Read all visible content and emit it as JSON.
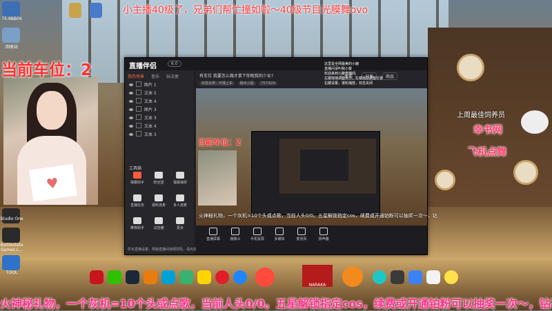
{
  "desktop": {
    "icons": [
      {
        "label": "75.9BB04",
        "color": "#3d6fb5"
      },
      {
        "label": "回收站",
        "color": "#7aa0c8"
      },
      {
        "label": "",
        "color": "#c9a34a"
      },
      {
        "label": "",
        "color": "#4a7bc9"
      },
      {
        "label": "Studio One",
        "color": "#2a2a2a"
      },
      {
        "label": "Battlestate Games L...",
        "color": "#2a2a2a"
      },
      {
        "label": "TOOL",
        "color": "#2f73c8"
      }
    ]
  },
  "overlays": {
    "top_banner": "小主播40级了，兄弟们帮忙撞如啦～40级节目光膜舞ovo",
    "car_position": "当前车位：2",
    "week_label": "上周最佳饲养员",
    "right_line1": "幸书网",
    "right_line2": "飞机点舞",
    "bottom_scroll": "火神秘礼物，一个灰机=10个头或点歌，当前人头0/0。五星解锁指定cos，续费或开通铂粉可以抽奖一次～，钻石"
  },
  "app": {
    "title": "直播伴侣",
    "version": "6.0",
    "sidebar_tabs": [
      "我的场景",
      "音乐",
      "玩法类"
    ],
    "scenes": [
      {
        "label": "图片 1"
      },
      {
        "label": "文本 5"
      },
      {
        "label": "文本 4"
      },
      {
        "label": "图片 3"
      },
      {
        "label": "文本 3"
      },
      {
        "label": "文本 4"
      },
      {
        "label": "文本 3"
      }
    ],
    "tools_header": "工具箱",
    "tools": [
      {
        "label": "弹幕助手",
        "color": "#ff5b3a"
      },
      {
        "label": "粉丝团",
        "color": "#e6e6e6"
      },
      {
        "label": "福袋抽奖",
        "color": "#e6e6e6"
      },
      {
        "label": "直播任务",
        "color": "#e6e6e6"
      },
      {
        "label": "视听连麦",
        "color": "#e6e6e6"
      },
      {
        "label": "多人连麦",
        "color": "#e6e6e6"
      },
      {
        "label": "推荐助手",
        "color": "#e6e6e6"
      },
      {
        "label": "试音棚",
        "color": "#e6e6e6"
      },
      {
        "label": "更多",
        "color": "#e6e6e6"
      }
    ],
    "footer_note": "优化直播设置，规避直播间违规风险，请点击查看并同意",
    "preview": {
      "title": "有车位 我要怎么做才拿下你呢我的少女?",
      "tags": [
        "标签名称：开播上车",
        "播出小屋",
        "757/924"
      ],
      "buttons": [
        "发布",
        "分享",
        "商品"
      ],
      "sub_line": "火神秘礼物，一个灰机=10个头或点歌，当前人头0/0。五星解锁指定cos，续费或开通铂粉可以抽奖一次～，钻"
    },
    "chat": [
      "这里是全网最美的小鹿",
      "直播间请叫我小葵",
      "欢迎来到小葵直播间",
      "左键拖拽调整大小，左键拖动调整位置",
      "右键设置，滚轮缩放，双击关闭"
    ],
    "controls": [
      {
        "label": "直播屏幕"
      },
      {
        "label": "摄像头"
      },
      {
        "label": "手机投屏"
      },
      {
        "label": "多媒体"
      },
      {
        "label": "麦克风"
      },
      {
        "label": "扬声器"
      }
    ]
  },
  "taskbar": {
    "apps": [
      {
        "name": "NetEase",
        "color": "#c8141c"
      },
      {
        "name": "WeChat",
        "color": "#2dc100"
      },
      {
        "name": "Steam",
        "color": "#1b2838"
      },
      {
        "name": "Blender",
        "color": "#e87d0d"
      },
      {
        "name": "Bilibili",
        "color": "#00a1d6"
      },
      {
        "name": "Nut",
        "color": "#37b26f"
      },
      {
        "name": "Cartoon",
        "color": "#ffd400"
      },
      {
        "name": "NetEase Music",
        "color": "#e11d2a"
      },
      {
        "name": "Kugou",
        "color": "#1e86ff"
      },
      {
        "name": "Bird",
        "color": "#ff4b3e"
      },
      {
        "name": "Naraka",
        "color": "#b41b1b"
      },
      {
        "name": "Orange O",
        "color": "#f28a1e"
      },
      {
        "name": "OBS",
        "color": "#1ec6c6"
      },
      {
        "name": "Kook",
        "color": "#3a3a3a"
      },
      {
        "name": "Game",
        "color": "#3b82f6"
      },
      {
        "name": "Sogou",
        "color": "#f3f3f3"
      },
      {
        "name": "Ring",
        "color": "#ffe14a"
      }
    ],
    "naraka_label": "NARAKA"
  }
}
